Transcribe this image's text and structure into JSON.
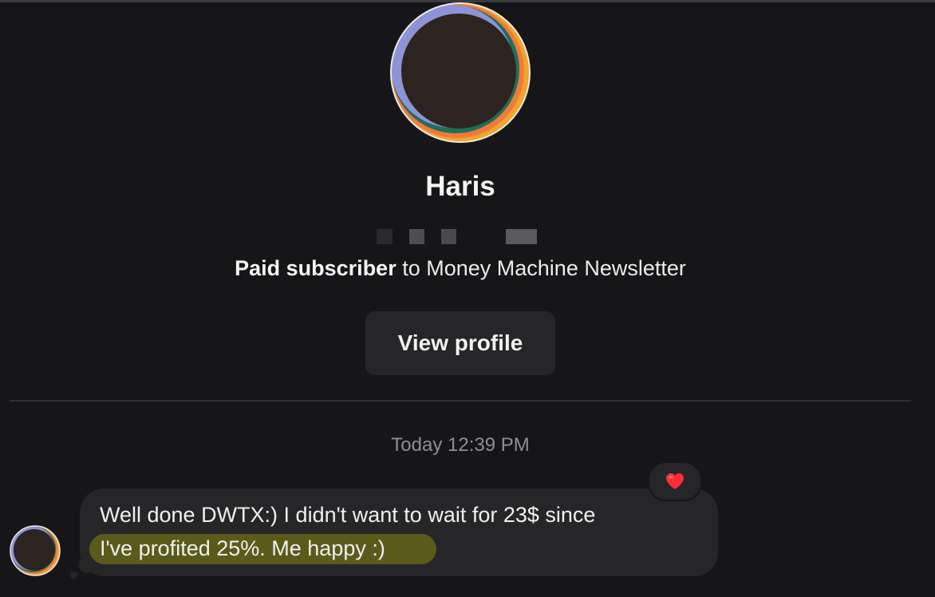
{
  "contact": {
    "name": "Haris",
    "subtitle_bold": "Paid subscriber",
    "subtitle_rest": " to Money Machine Newsletter",
    "avatar_icon": "profile-photo",
    "handle_pixelated": true
  },
  "actions": {
    "view_profile_label": "View profile"
  },
  "thread": {
    "timestamp": "Today 12:39 PM",
    "messages": [
      {
        "line1": "Well done DWTX:) I didn't want to wait for 23$ since",
        "line2": "I've profited 25%. Me happy :)",
        "reaction": "❤️",
        "highlight_color": "#5c5a1b"
      }
    ]
  },
  "colors": {
    "background": "#161618",
    "bubble": "#262628",
    "muted_text": "#8e8e93"
  }
}
